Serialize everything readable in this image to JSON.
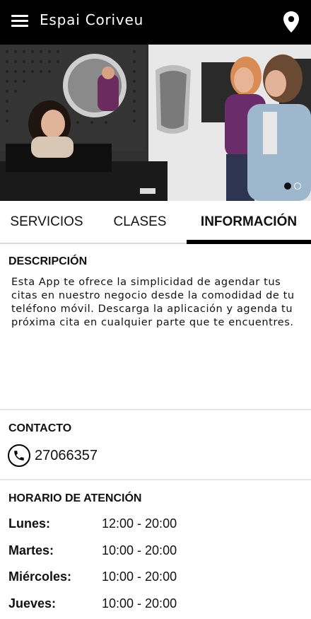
{
  "appbar": {
    "title": "Espai Coriveu",
    "menu_icon": "hamburger-menu-icon",
    "location_icon": "location-pin-icon"
  },
  "carousel": {
    "slides": 2,
    "active_index": 0
  },
  "tabs": [
    {
      "label": "SERVICIOS",
      "active": false
    },
    {
      "label": "CLASES",
      "active": false
    },
    {
      "label": "INFORMACIÓN",
      "active": true
    }
  ],
  "description": {
    "title": "DESCRIPCIÓN",
    "text": "Esta App te ofrece la simplicidad de agendar tus citas en nuestro negocio desde la comodidad de tu teléfono móvil. Descarga la aplicación y agenda tu próxima cita en cualquier parte que te encuentres."
  },
  "contact": {
    "title": "CONTACTO",
    "phone": "27066357",
    "phone_icon": "phone-icon"
  },
  "schedule": {
    "title": "HORARIO DE ATENCIÓN",
    "rows": [
      {
        "day": "Lunes:",
        "hours": "12:00 - 20:00"
      },
      {
        "day": "Martes:",
        "hours": "10:00 - 20:00"
      },
      {
        "day": "Miércoles:",
        "hours": "10:00 - 20:00"
      },
      {
        "day": "Jueves:",
        "hours": "10:00 - 20:00"
      }
    ]
  },
  "colors": {
    "appbar_bg": "#000000",
    "text": "#111111",
    "divider": "#e6e6e6"
  }
}
